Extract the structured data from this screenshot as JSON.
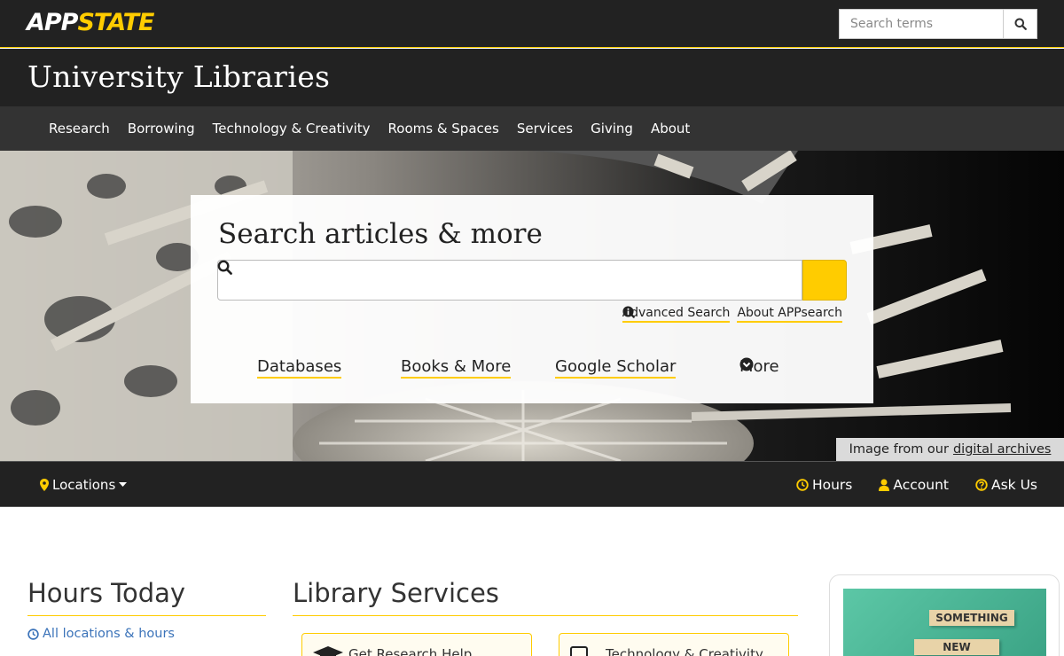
{
  "brand": {
    "app": "APP",
    "state": "STATE"
  },
  "top_search": {
    "placeholder": "Search terms"
  },
  "site_title": "University Libraries",
  "nav": [
    "Research",
    "Borrowing",
    "Technology & Creativity",
    "Rooms & Spaces",
    "Services",
    "Giving",
    "About"
  ],
  "hero_search": {
    "heading": "Search articles & more",
    "advanced_label": "Advanced Search",
    "about_label": "About APPsearch",
    "tabs": [
      "Databases",
      "Books & More",
      "Google Scholar",
      "More"
    ]
  },
  "archive_note": {
    "prefix": "Image from our",
    "link": "digital archives"
  },
  "utility": {
    "locations": "Locations",
    "hours": "Hours",
    "account": "Account",
    "ask": "Ask Us"
  },
  "hours": {
    "heading": "Hours Today",
    "all_link": "All locations & hours"
  },
  "services": {
    "heading": "Library Services",
    "cards": [
      "Get Research Help",
      "Technology & Creativity"
    ]
  },
  "promo": {
    "words": [
      "SOMETHING",
      "NEW"
    ]
  },
  "colors": {
    "accent": "#ffcc00",
    "dark": "#222222",
    "nav": "#333333",
    "link": "#3b73b9"
  }
}
